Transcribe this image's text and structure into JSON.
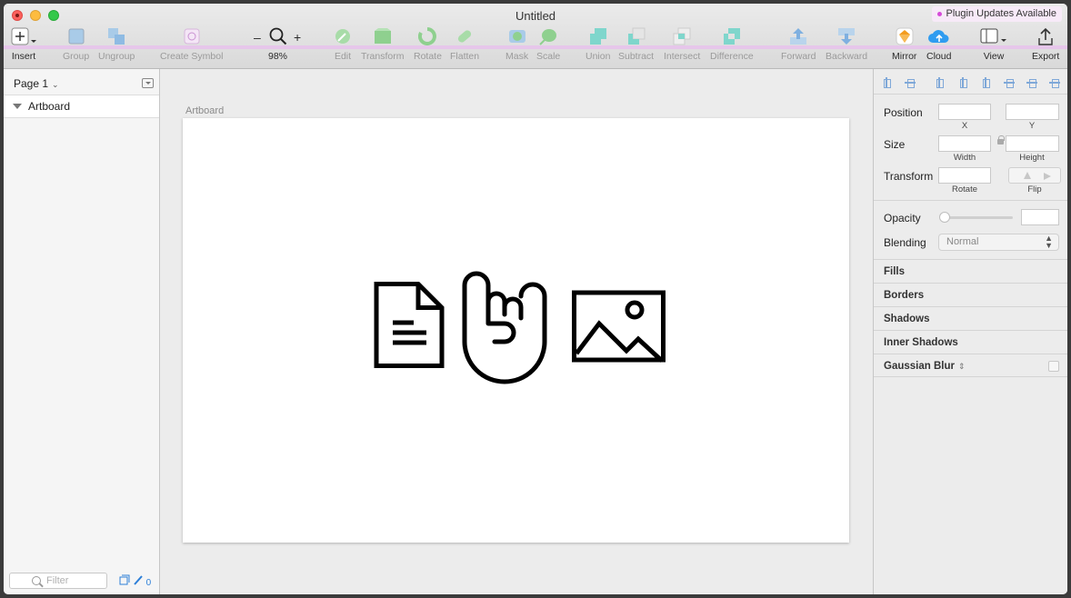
{
  "window": {
    "title": "Untitled",
    "plugin_badge": "Plugin Updates Available"
  },
  "toolbar": {
    "insert": "Insert",
    "group": "Group",
    "ungroup": "Ungroup",
    "create_symbol": "Create Symbol",
    "zoom_minus": "–",
    "zoom_plus": "+",
    "zoom_level": "98%",
    "edit": "Edit",
    "transform": "Transform",
    "rotate": "Rotate",
    "flatten": "Flatten",
    "mask": "Mask",
    "scale": "Scale",
    "union": "Union",
    "subtract": "Subtract",
    "intersect": "Intersect",
    "difference": "Difference",
    "forward": "Forward",
    "backward": "Backward",
    "mirror": "Mirror",
    "cloud": "Cloud",
    "view": "View",
    "export": "Export"
  },
  "layers": {
    "page_name": "Page 1",
    "items": [
      {
        "label": "Artboard"
      }
    ],
    "filter_placeholder": "Filter",
    "slice_count": "0"
  },
  "canvas": {
    "artboard_label": "Artboard",
    "icons": [
      "document-icon",
      "rock-hand-icon",
      "image-icon"
    ]
  },
  "inspector": {
    "position_label": "Position",
    "x_label": "X",
    "y_label": "Y",
    "size_label": "Size",
    "width_label": "Width",
    "height_label": "Height",
    "transform_label": "Transform",
    "rotate_label": "Rotate",
    "flip_label": "Flip",
    "opacity_label": "Opacity",
    "blending_label": "Blending",
    "blending_value": "Normal",
    "sections": {
      "fills": "Fills",
      "borders": "Borders",
      "shadows": "Shadows",
      "inner_shadows": "Inner Shadows",
      "gaussian_blur": "Gaussian Blur"
    }
  },
  "colors": {
    "accent_pink": "#e6c6ea",
    "cloud_blue": "#2f9cf0",
    "mirror_orange": "#f39c1f",
    "disabled_green": "#8fd08f",
    "disabled_teal": "#7fd6cc"
  }
}
